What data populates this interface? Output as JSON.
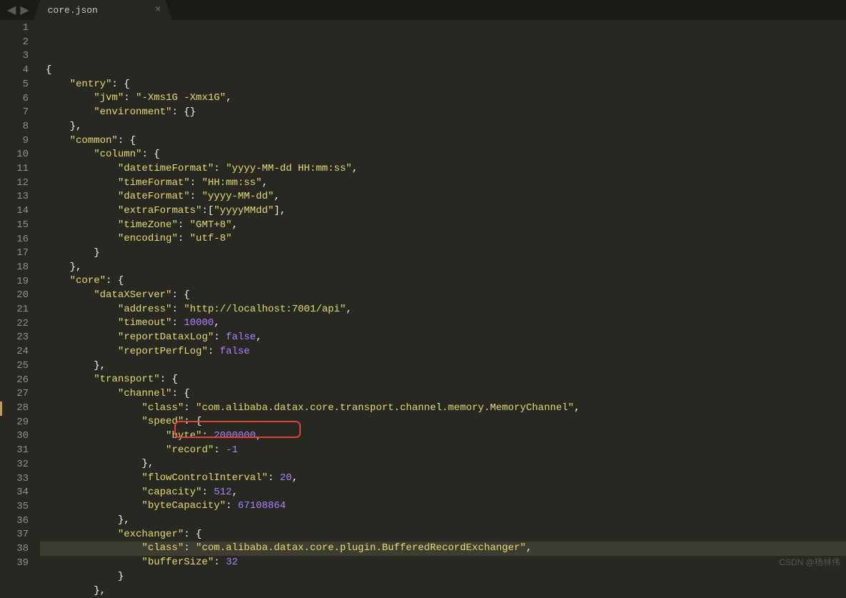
{
  "tab": {
    "filename": "core.json",
    "close": "×"
  },
  "nav": {
    "back": "◀",
    "forward": "▶"
  },
  "watermark": "CSDN @杨林伟",
  "code": {
    "lines": [
      {
        "n": 1,
        "tokens": [
          {
            "t": "",
            "c": "p"
          }
        ]
      },
      {
        "n": 2,
        "tokens": [
          {
            "t": "{",
            "c": "p"
          }
        ]
      },
      {
        "n": 3,
        "tokens": [
          {
            "t": "    ",
            "c": "p"
          },
          {
            "t": "\"entry\"",
            "c": "k"
          },
          {
            "t": ": {",
            "c": "p"
          }
        ]
      },
      {
        "n": 4,
        "tokens": [
          {
            "t": "        ",
            "c": "p"
          },
          {
            "t": "\"jvm\"",
            "c": "k"
          },
          {
            "t": ": ",
            "c": "p"
          },
          {
            "t": "\"-Xms1G -Xmx1G\"",
            "c": "s"
          },
          {
            "t": ",",
            "c": "p"
          }
        ]
      },
      {
        "n": 5,
        "tokens": [
          {
            "t": "        ",
            "c": "p"
          },
          {
            "t": "\"environment\"",
            "c": "k"
          },
          {
            "t": ": {}",
            "c": "p"
          }
        ]
      },
      {
        "n": 6,
        "tokens": [
          {
            "t": "    },",
            "c": "p"
          }
        ]
      },
      {
        "n": 7,
        "tokens": [
          {
            "t": "    ",
            "c": "p"
          },
          {
            "t": "\"common\"",
            "c": "k"
          },
          {
            "t": ": {",
            "c": "p"
          }
        ]
      },
      {
        "n": 8,
        "tokens": [
          {
            "t": "        ",
            "c": "p"
          },
          {
            "t": "\"column\"",
            "c": "k"
          },
          {
            "t": ": {",
            "c": "p"
          }
        ]
      },
      {
        "n": 9,
        "tokens": [
          {
            "t": "            ",
            "c": "p"
          },
          {
            "t": "\"datetimeFormat\"",
            "c": "k"
          },
          {
            "t": ": ",
            "c": "p"
          },
          {
            "t": "\"yyyy-MM-dd HH:mm:ss\"",
            "c": "s"
          },
          {
            "t": ",",
            "c": "p"
          }
        ]
      },
      {
        "n": 10,
        "tokens": [
          {
            "t": "            ",
            "c": "p"
          },
          {
            "t": "\"timeFormat\"",
            "c": "k"
          },
          {
            "t": ": ",
            "c": "p"
          },
          {
            "t": "\"HH:mm:ss\"",
            "c": "s"
          },
          {
            "t": ",",
            "c": "p"
          }
        ]
      },
      {
        "n": 11,
        "tokens": [
          {
            "t": "            ",
            "c": "p"
          },
          {
            "t": "\"dateFormat\"",
            "c": "k"
          },
          {
            "t": ": ",
            "c": "p"
          },
          {
            "t": "\"yyyy-MM-dd\"",
            "c": "s"
          },
          {
            "t": ",",
            "c": "p"
          }
        ]
      },
      {
        "n": 12,
        "tokens": [
          {
            "t": "            ",
            "c": "p"
          },
          {
            "t": "\"extraFormats\"",
            "c": "k"
          },
          {
            "t": ":[",
            "c": "p"
          },
          {
            "t": "\"yyyyMMdd\"",
            "c": "s"
          },
          {
            "t": "],",
            "c": "p"
          }
        ]
      },
      {
        "n": 13,
        "tokens": [
          {
            "t": "            ",
            "c": "p"
          },
          {
            "t": "\"timeZone\"",
            "c": "k"
          },
          {
            "t": ": ",
            "c": "p"
          },
          {
            "t": "\"GMT+8\"",
            "c": "s"
          },
          {
            "t": ",",
            "c": "p"
          }
        ]
      },
      {
        "n": 14,
        "tokens": [
          {
            "t": "            ",
            "c": "p"
          },
          {
            "t": "\"encoding\"",
            "c": "k"
          },
          {
            "t": ": ",
            "c": "p"
          },
          {
            "t": "\"utf-8\"",
            "c": "s"
          }
        ]
      },
      {
        "n": 15,
        "tokens": [
          {
            "t": "        }",
            "c": "p"
          }
        ]
      },
      {
        "n": 16,
        "tokens": [
          {
            "t": "    },",
            "c": "p"
          }
        ]
      },
      {
        "n": 17,
        "tokens": [
          {
            "t": "    ",
            "c": "p"
          },
          {
            "t": "\"core\"",
            "c": "k"
          },
          {
            "t": ": {",
            "c": "p"
          }
        ]
      },
      {
        "n": 18,
        "tokens": [
          {
            "t": "        ",
            "c": "p"
          },
          {
            "t": "\"dataXServer\"",
            "c": "k"
          },
          {
            "t": ": {",
            "c": "p"
          }
        ]
      },
      {
        "n": 19,
        "tokens": [
          {
            "t": "            ",
            "c": "p"
          },
          {
            "t": "\"address\"",
            "c": "k"
          },
          {
            "t": ": ",
            "c": "p"
          },
          {
            "t": "\"http://localhost:7001/api\"",
            "c": "s"
          },
          {
            "t": ",",
            "c": "p"
          }
        ]
      },
      {
        "n": 20,
        "tokens": [
          {
            "t": "            ",
            "c": "p"
          },
          {
            "t": "\"timeout\"",
            "c": "k"
          },
          {
            "t": ": ",
            "c": "p"
          },
          {
            "t": "10000",
            "c": "n"
          },
          {
            "t": ",",
            "c": "p"
          }
        ]
      },
      {
        "n": 21,
        "tokens": [
          {
            "t": "            ",
            "c": "p"
          },
          {
            "t": "\"reportDataxLog\"",
            "c": "k"
          },
          {
            "t": ": ",
            "c": "p"
          },
          {
            "t": "false",
            "c": "b"
          },
          {
            "t": ",",
            "c": "p"
          }
        ]
      },
      {
        "n": 22,
        "tokens": [
          {
            "t": "            ",
            "c": "p"
          },
          {
            "t": "\"reportPerfLog\"",
            "c": "k"
          },
          {
            "t": ": ",
            "c": "p"
          },
          {
            "t": "false",
            "c": "b"
          }
        ]
      },
      {
        "n": 23,
        "tokens": [
          {
            "t": "        },",
            "c": "p"
          }
        ]
      },
      {
        "n": 24,
        "tokens": [
          {
            "t": "        ",
            "c": "p"
          },
          {
            "t": "\"transport\"",
            "c": "k"
          },
          {
            "t": ": {",
            "c": "p"
          }
        ]
      },
      {
        "n": 25,
        "tokens": [
          {
            "t": "            ",
            "c": "p"
          },
          {
            "t": "\"channel\"",
            "c": "k"
          },
          {
            "t": ": {",
            "c": "p"
          }
        ]
      },
      {
        "n": 26,
        "tokens": [
          {
            "t": "                ",
            "c": "p"
          },
          {
            "t": "\"class\"",
            "c": "k"
          },
          {
            "t": ": ",
            "c": "p"
          },
          {
            "t": "\"com.alibaba.datax.core.transport.channel.memory.MemoryChannel\"",
            "c": "s"
          },
          {
            "t": ",",
            "c": "p"
          }
        ]
      },
      {
        "n": 27,
        "tokens": [
          {
            "t": "                ",
            "c": "p"
          },
          {
            "t": "\"speed\"",
            "c": "k"
          },
          {
            "t": ": {",
            "c": "p"
          }
        ]
      },
      {
        "n": 28,
        "mod": true,
        "tokens": [
          {
            "t": "                    ",
            "c": "p"
          },
          {
            "t": "\"byte\"",
            "c": "k"
          },
          {
            "t": ": ",
            "c": "p"
          },
          {
            "t": "2000000",
            "c": "n"
          },
          {
            "t": ",",
            "c": "p"
          }
        ]
      },
      {
        "n": 29,
        "tokens": [
          {
            "t": "                    ",
            "c": "p"
          },
          {
            "t": "\"record\"",
            "c": "k"
          },
          {
            "t": ": ",
            "c": "p"
          },
          {
            "t": "-1",
            "c": "n"
          }
        ]
      },
      {
        "n": 30,
        "tokens": [
          {
            "t": "                },",
            "c": "p"
          }
        ]
      },
      {
        "n": 31,
        "tokens": [
          {
            "t": "                ",
            "c": "p"
          },
          {
            "t": "\"flowControlInterval\"",
            "c": "k"
          },
          {
            "t": ": ",
            "c": "p"
          },
          {
            "t": "20",
            "c": "n"
          },
          {
            "t": ",",
            "c": "p"
          }
        ]
      },
      {
        "n": 32,
        "tokens": [
          {
            "t": "                ",
            "c": "p"
          },
          {
            "t": "\"capacity\"",
            "c": "k"
          },
          {
            "t": ": ",
            "c": "p"
          },
          {
            "t": "512",
            "c": "n"
          },
          {
            "t": ",",
            "c": "p"
          }
        ]
      },
      {
        "n": 33,
        "tokens": [
          {
            "t": "                ",
            "c": "p"
          },
          {
            "t": "\"byteCapacity\"",
            "c": "k"
          },
          {
            "t": ": ",
            "c": "p"
          },
          {
            "t": "67108864",
            "c": "n"
          }
        ]
      },
      {
        "n": 34,
        "tokens": [
          {
            "t": "            },",
            "c": "p"
          }
        ]
      },
      {
        "n": 35,
        "tokens": [
          {
            "t": "            ",
            "c": "p"
          },
          {
            "t": "\"exchanger\"",
            "c": "k"
          },
          {
            "t": ": {",
            "c": "p"
          }
        ]
      },
      {
        "n": 36,
        "hl": true,
        "tokens": [
          {
            "t": "                ",
            "c": "p"
          },
          {
            "t": "\"class\"",
            "c": "k"
          },
          {
            "t": ": ",
            "c": "p"
          },
          {
            "t": "\"com.alibaba.datax.core.plugin.BufferedRecordExchanger\"",
            "c": "s"
          },
          {
            "t": ",",
            "c": "p"
          }
        ]
      },
      {
        "n": 37,
        "tokens": [
          {
            "t": "                ",
            "c": "p"
          },
          {
            "t": "\"bufferSize\"",
            "c": "k"
          },
          {
            "t": ": ",
            "c": "p"
          },
          {
            "t": "32",
            "c": "n"
          }
        ]
      },
      {
        "n": 38,
        "tokens": [
          {
            "t": "            }",
            "c": "p"
          }
        ]
      },
      {
        "n": 39,
        "tokens": [
          {
            "t": "        },",
            "c": "p"
          }
        ]
      }
    ]
  }
}
